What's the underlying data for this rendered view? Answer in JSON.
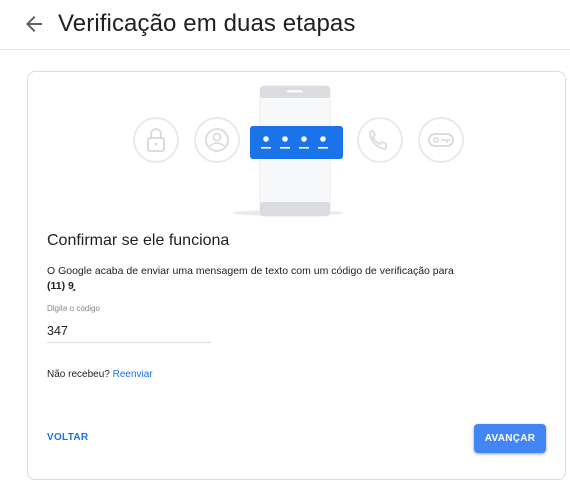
{
  "header": {
    "title": "Verificação em duas etapas",
    "back_icon": "arrow-back-icon"
  },
  "illustration": {
    "icons": [
      "lock-icon",
      "account-icon",
      "password-dots-icon",
      "phone-icon",
      "key-icon"
    ],
    "accent_color": "#1a73e8",
    "circle_color": "#e8eaed"
  },
  "main": {
    "section_title": "Confirmar se ele funciona",
    "description": "O Google acaba de enviar uma mensagem de texto com um código de verificação para",
    "phone_number": "(11) 9̧",
    "code_label": "Digite o código",
    "code_value": "347",
    "resend_prompt": "Não recebeu?",
    "resend_link": "Reenviar"
  },
  "actions": {
    "back_label": "VOLTAR",
    "next_label": "AVANÇAR"
  },
  "colors": {
    "primary": "#4285f4",
    "link": "#1a73e8",
    "text": "#202124",
    "muted": "#80868b",
    "border": "#dadce0"
  }
}
